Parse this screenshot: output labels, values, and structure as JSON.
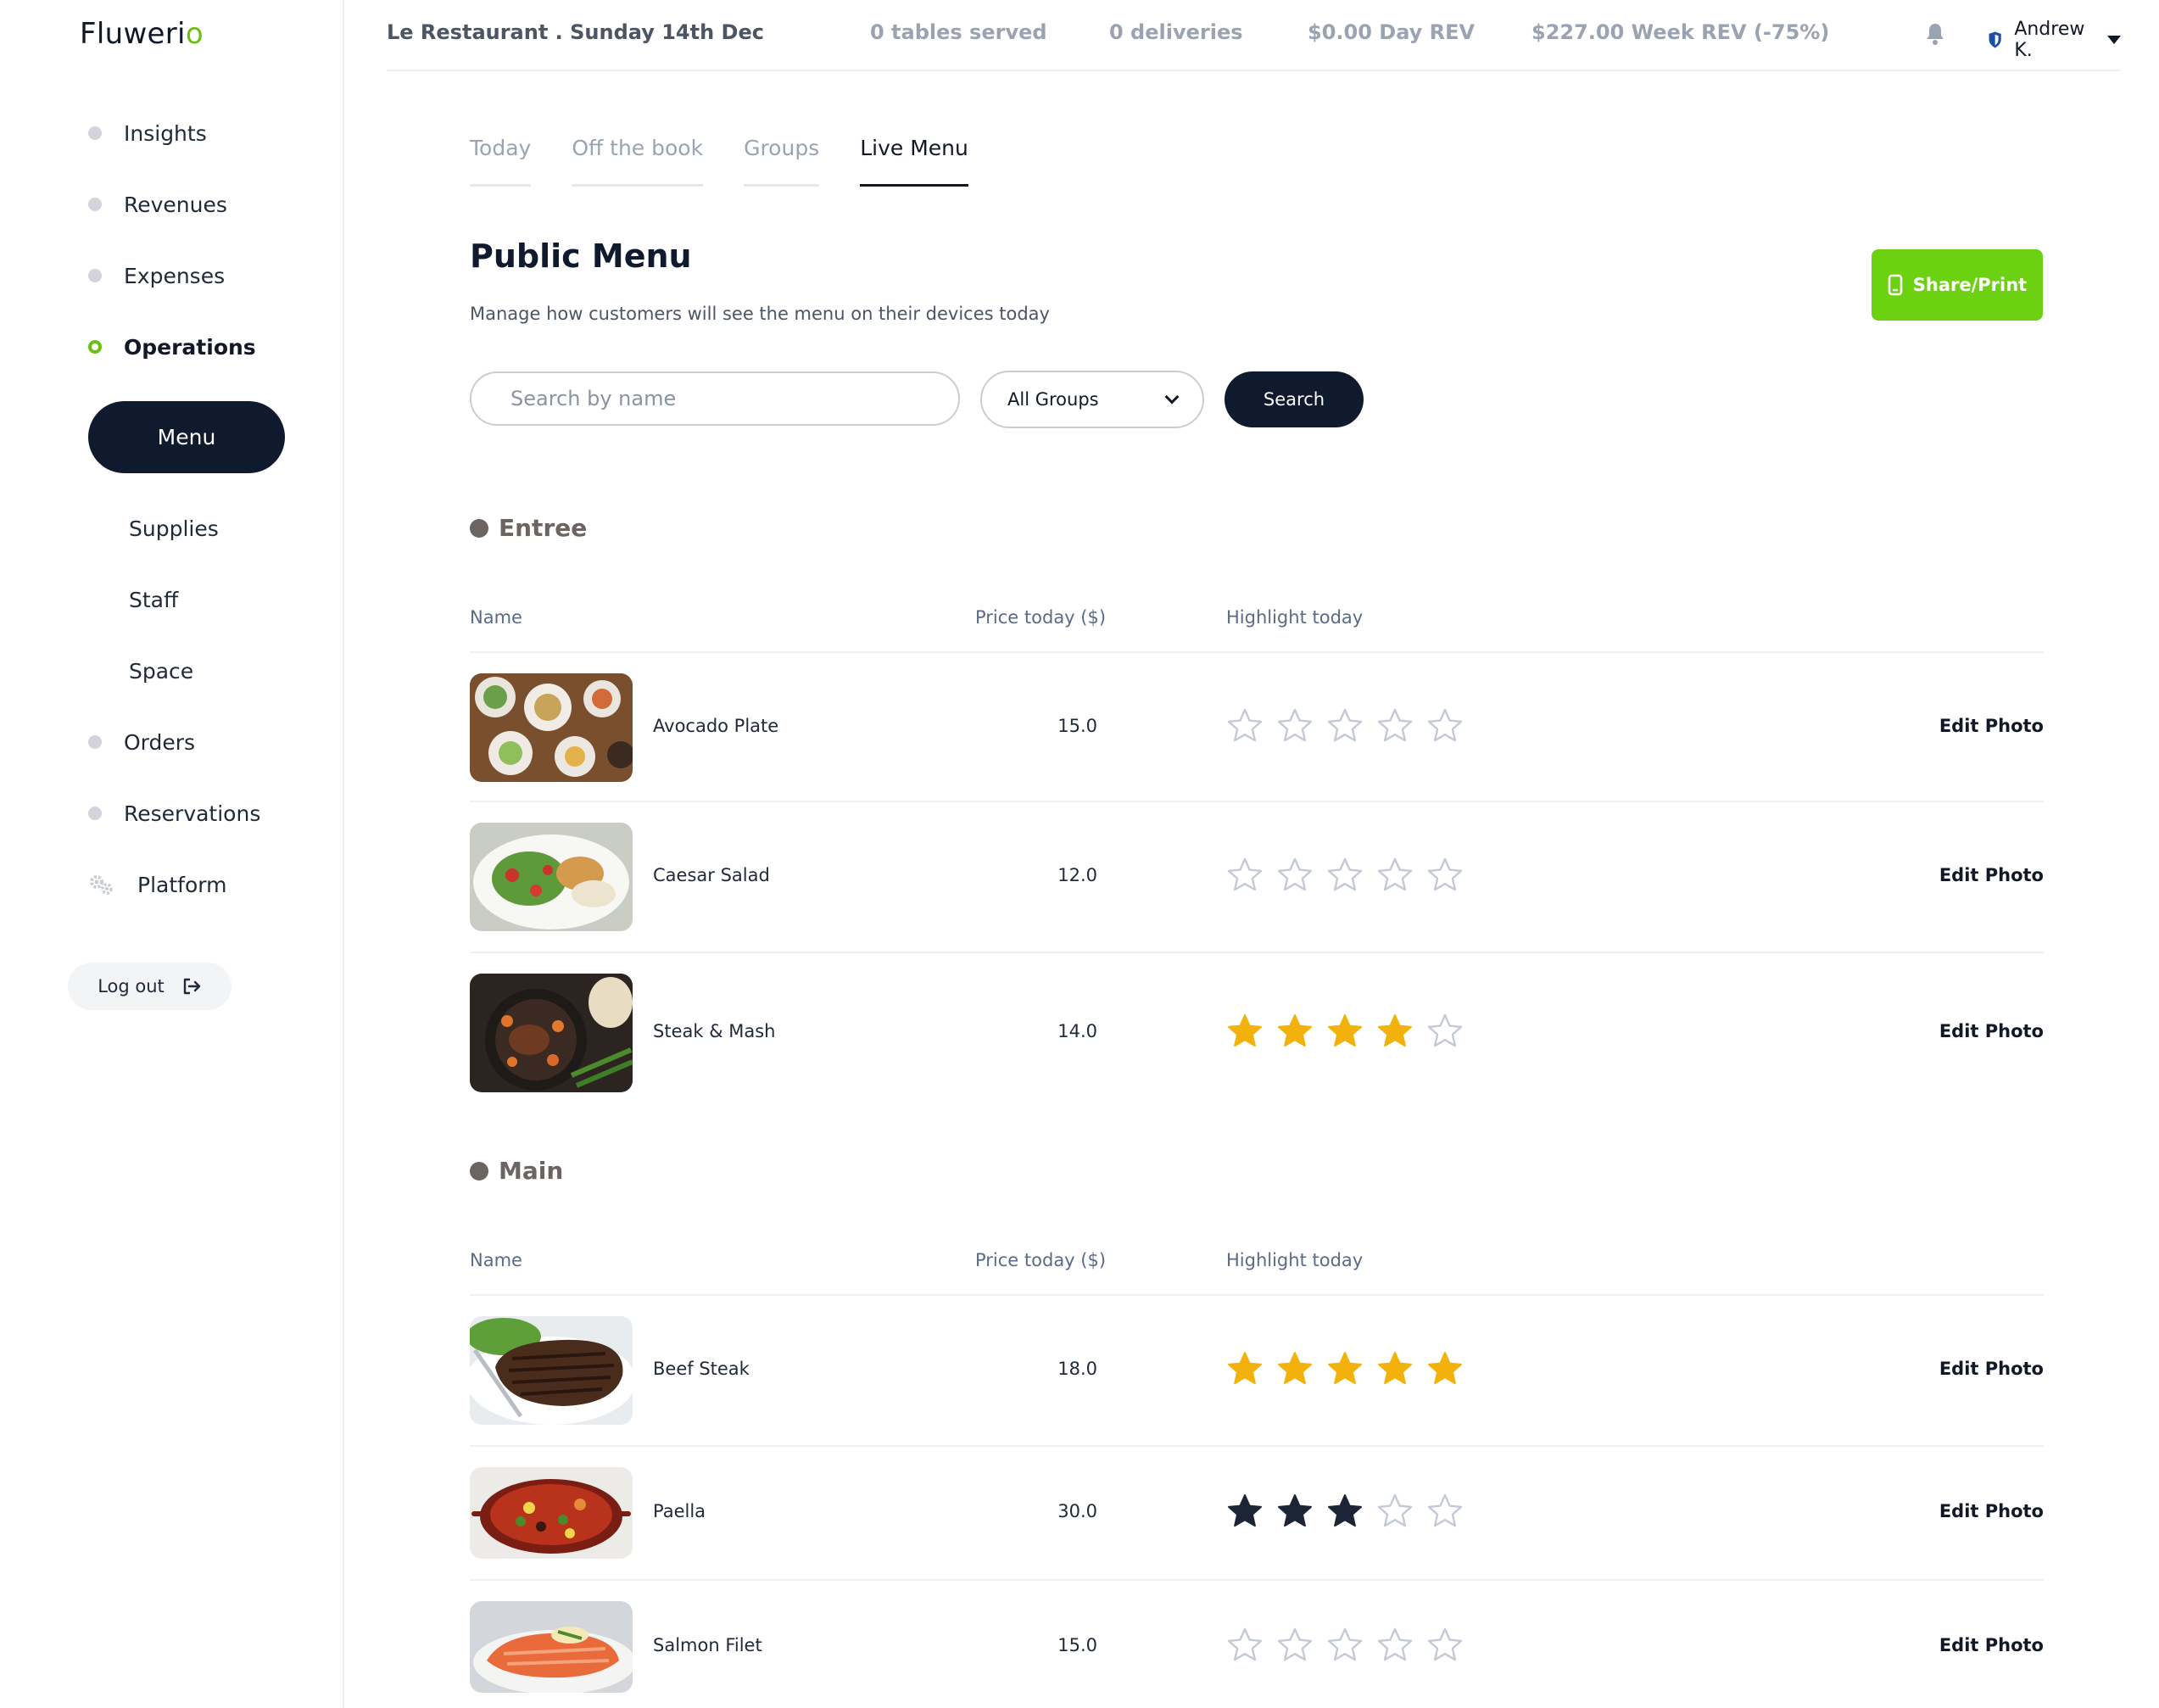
{
  "app": {
    "logo_main": "Fluweri",
    "logo_accent": "o"
  },
  "sidebar": {
    "items": [
      {
        "label": "Insights"
      },
      {
        "label": "Revenues"
      },
      {
        "label": "Expenses"
      },
      {
        "label": "Operations"
      },
      {
        "label": "Menu"
      },
      {
        "label": "Supplies"
      },
      {
        "label": "Staff"
      },
      {
        "label": "Space"
      },
      {
        "label": "Orders"
      },
      {
        "label": "Reservations"
      },
      {
        "label": "Platform"
      }
    ],
    "logout_label": "Log out"
  },
  "topbar": {
    "title": "Le Restaurant . Sunday 14th Dec",
    "stats": [
      "0 tables served",
      "0 deliveries",
      "$0.00 Day REV",
      "$227.00 Week REV (-75%)"
    ],
    "user": "Andrew K."
  },
  "tabs": [
    "Today",
    "Off the book",
    "Groups",
    "Live Menu"
  ],
  "header": {
    "title": "Public Menu",
    "subtitle": "Manage how customers will see the menu on their devices today",
    "share_label": "Share/Print"
  },
  "search": {
    "placeholder": "Search by name",
    "group_selected": "All Groups",
    "button_label": "Search"
  },
  "columns": {
    "name": "Name",
    "price": "Price today ($)",
    "highlight": "Highlight today"
  },
  "edit_photo_label": "Edit Photo",
  "colors": {
    "accent_green": "#6bd111",
    "star_gold": "#f2b20b",
    "star_dark": "#1c2536",
    "star_empty": "#c3cad6",
    "navy": "#0f1a2e"
  },
  "sections": [
    {
      "name": "Entree",
      "items": [
        {
          "name": "Avocado Plate",
          "price": "15.0",
          "rating": 0,
          "star_style": "empty"
        },
        {
          "name": "Caesar Salad",
          "price": "12.0",
          "rating": 0,
          "star_style": "empty"
        },
        {
          "name": "Steak & Mash",
          "price": "14.0",
          "rating": 4,
          "star_style": "gold"
        }
      ]
    },
    {
      "name": "Main",
      "items": [
        {
          "name": "Beef Steak",
          "price": "18.0",
          "rating": 5,
          "star_style": "gold"
        },
        {
          "name": "Paella",
          "price": "30.0",
          "rating": 3,
          "star_style": "dark"
        },
        {
          "name": "Salmon Filet",
          "price": "15.0",
          "rating": 0,
          "star_style": "empty"
        }
      ]
    }
  ]
}
